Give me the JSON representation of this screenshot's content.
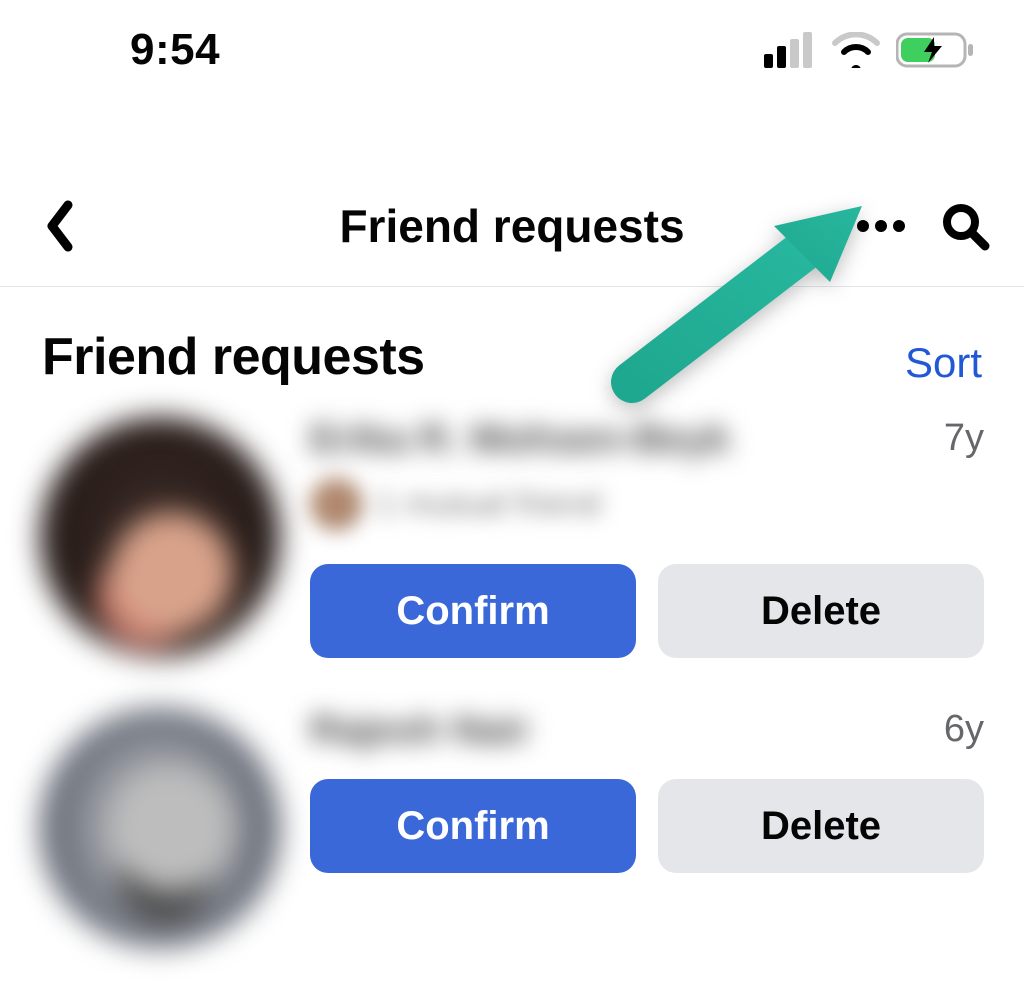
{
  "status": {
    "time": "9:54"
  },
  "nav": {
    "title": "Friend requests"
  },
  "section": {
    "title": "Friend requests",
    "sort_label": "Sort"
  },
  "buttons": {
    "confirm": "Confirm",
    "delete": "Delete"
  },
  "requests": [
    {
      "name": "Erika R. Mohsen-Beyk",
      "time_ago": "7y",
      "mutual_text": "1 mutual friend"
    },
    {
      "name": "Rajesh Nair",
      "time_ago": "6y"
    }
  ],
  "colors": {
    "accent": "#3a68d8",
    "link": "#2158d7",
    "secondary_bg": "#e5e6ea",
    "annotation": "#1fa890"
  }
}
